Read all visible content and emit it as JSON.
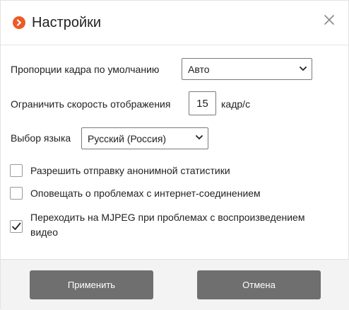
{
  "dialog": {
    "title": "Настройки",
    "logo_icon": "orange-chevron-right-icon",
    "close_icon": "close-icon"
  },
  "settings": {
    "aspect_ratio": {
      "label": "Пропорции кадра по умолчанию",
      "selected": "Авто"
    },
    "fps_limit": {
      "label": "Ограничить скорость отображения",
      "value": "15",
      "unit": "кадр/с"
    },
    "language": {
      "label": "Выбор языка",
      "selected": "Русский (Россия)"
    }
  },
  "checkboxes": [
    {
      "label": "Разрешить отправку анонимной статистики",
      "checked": false
    },
    {
      "label": "Оповещать о проблемах с интернет-соединением",
      "checked": false
    },
    {
      "label": "Переходить на MJPEG при проблемах с воспроизведением видео",
      "checked": true
    }
  ],
  "footer": {
    "apply_label": "Применить",
    "cancel_label": "Отмена"
  },
  "colors": {
    "accent": "#ee5a24",
    "button": "#6f6f6f",
    "footer_bg": "#f3f3f3"
  }
}
